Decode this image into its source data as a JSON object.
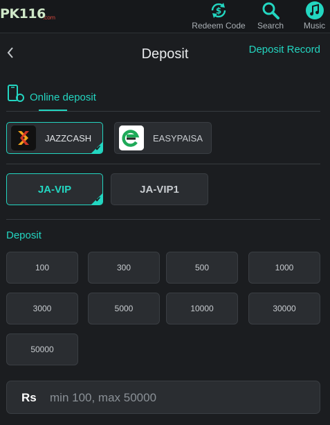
{
  "brand": {
    "logo_text": "PK116",
    "logo_suffix": ".com"
  },
  "topnav": [
    {
      "label": "Redeem Code",
      "icon": "dollar-refresh-icon"
    },
    {
      "label": "Search",
      "icon": "search-icon"
    },
    {
      "label": "Music",
      "icon": "music-note-icon"
    }
  ],
  "header": {
    "title": "Deposit",
    "record_link": "Deposit Record",
    "back_icon": "chevron-left-icon"
  },
  "tab": {
    "label": "Online deposit",
    "icon": "phone-deposit-icon"
  },
  "methods": [
    {
      "label": "JAZZCASH",
      "selected": true
    },
    {
      "label": "EASYPAISA",
      "selected": false
    }
  ],
  "channels": [
    {
      "label": "JA-VIP",
      "selected": true
    },
    {
      "label": "JA-VIP1",
      "selected": false
    }
  ],
  "deposit": {
    "title": "Deposit",
    "amounts": [
      "100",
      "300",
      "500",
      "1000",
      "3000",
      "5000",
      "10000",
      "30000",
      "50000"
    ]
  },
  "input": {
    "currency": "Rs",
    "placeholder": "min 100, max 50000",
    "value": ""
  },
  "colors": {
    "accent": "#23d6c1",
    "background": "#1b1d20",
    "card": "#2a2d31"
  }
}
